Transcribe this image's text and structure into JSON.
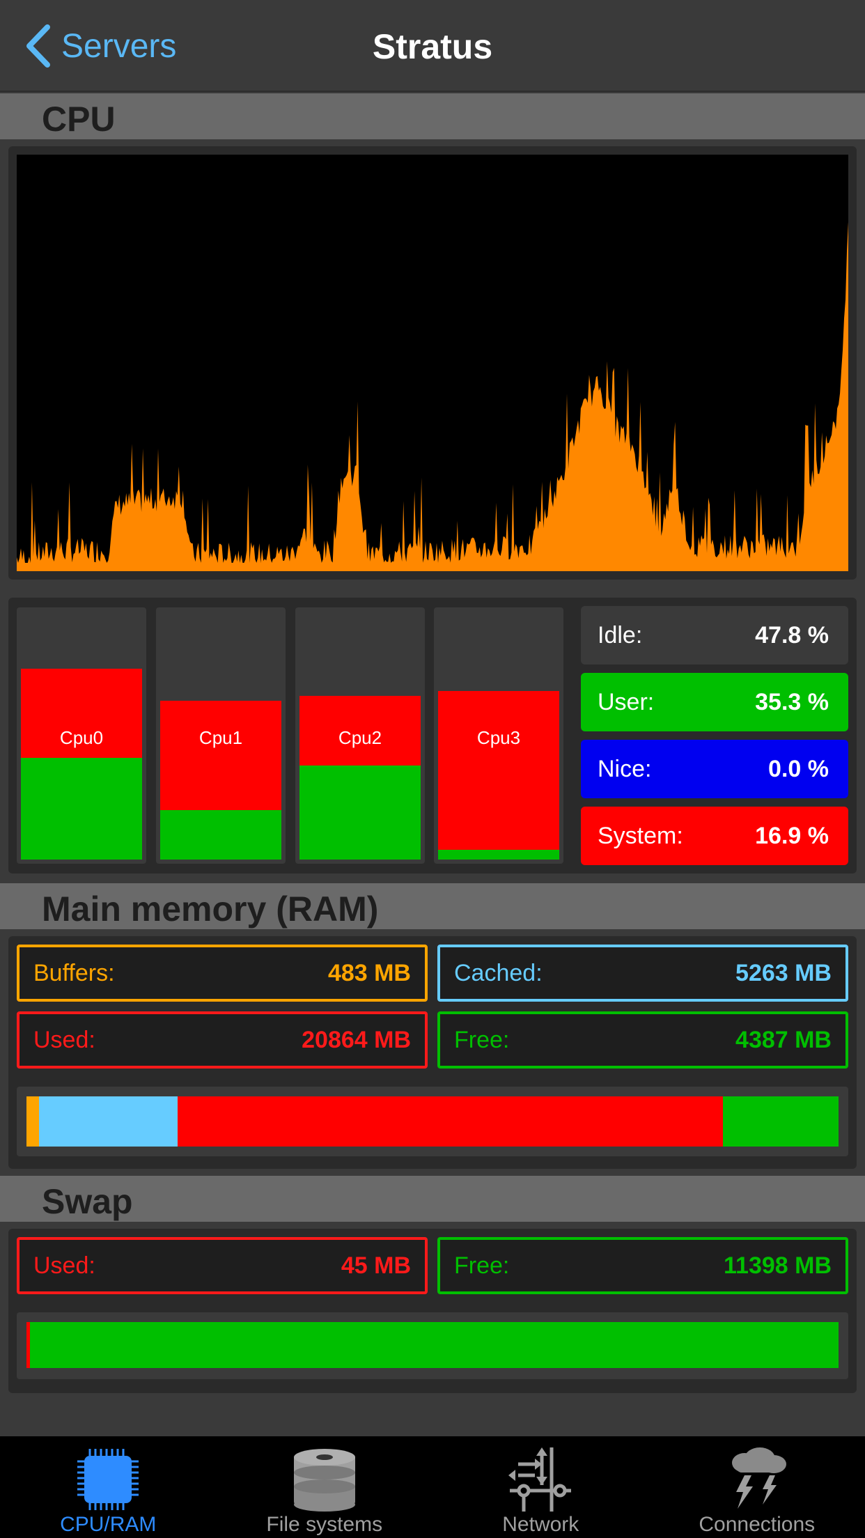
{
  "nav": {
    "back_label": "Servers",
    "title": "Stratus"
  },
  "sections": {
    "cpu": "CPU",
    "ram": "Main memory (RAM)",
    "swap": "Swap"
  },
  "cpu": {
    "cores": [
      {
        "label": "Cpu0",
        "total_pct": 77,
        "user_pct": 41
      },
      {
        "label": "Cpu1",
        "total_pct": 64,
        "user_pct": 20
      },
      {
        "label": "Cpu2",
        "total_pct": 66,
        "user_pct": 38
      },
      {
        "label": "Cpu3",
        "total_pct": 68,
        "user_pct": 4
      }
    ],
    "stats": [
      {
        "label": "Idle:",
        "value": "47.8 %",
        "color": "#3a3a3a"
      },
      {
        "label": "User:",
        "value": "35.3 %",
        "color": "#00bf00"
      },
      {
        "label": "Nice:",
        "value": "0.0 %",
        "color": "#0000f0"
      },
      {
        "label": "System:",
        "value": "16.9 %",
        "color": "#ff0000"
      }
    ]
  },
  "ram": {
    "buffers": {
      "label": "Buffers:",
      "value": "483 MB",
      "color": "#ffa500"
    },
    "cached": {
      "label": "Cached:",
      "value": "5263 MB",
      "color": "#66ccff"
    },
    "used": {
      "label": "Used:",
      "value": "20864 MB",
      "color": "#ff1a1a"
    },
    "free": {
      "label": "Free:",
      "value": "4387 MB",
      "color": "#00bf00"
    },
    "bar_fractions": {
      "buffers": 0.0158,
      "cached": 0.1702,
      "used": 0.672,
      "free": 0.142
    }
  },
  "swap": {
    "used": {
      "label": "Used:",
      "value": "45 MB",
      "color": "#ff1a1a"
    },
    "free": {
      "label": "Free:",
      "value": "11398 MB",
      "color": "#00bf00"
    },
    "bar_fractions": {
      "used": 0.004,
      "free": 0.996
    }
  },
  "tabs": [
    {
      "label": "CPU/RAM",
      "icon": "cpu-chip-icon",
      "active": true
    },
    {
      "label": "File systems",
      "icon": "disk-stack-icon",
      "active": false
    },
    {
      "label": "Network",
      "icon": "network-icon",
      "active": false
    },
    {
      "label": "Connections",
      "icon": "storm-cloud-icon",
      "active": false
    }
  ],
  "colors": {
    "accent": "#2e8cff",
    "graph": "#ff8800",
    "back": "#5ab8f5"
  }
}
